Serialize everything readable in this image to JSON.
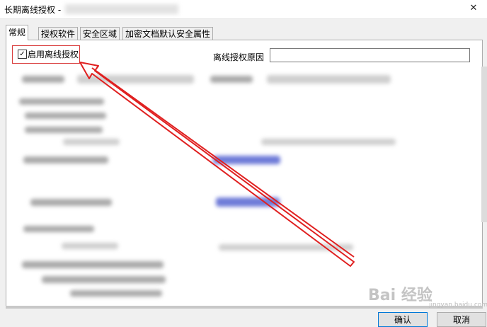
{
  "window": {
    "title": "长期离线授权 -",
    "close_glyph": "✕"
  },
  "tabs": [
    {
      "label": "常规",
      "active": true
    },
    {
      "label": "授权软件"
    },
    {
      "label": "安全区域"
    },
    {
      "label": "加密文档默认安全属性"
    }
  ],
  "general": {
    "enable_offline_checkbox": {
      "label": "启用离线授权",
      "checked": true
    },
    "reason_label": "离线授权原因",
    "reason_value": ""
  },
  "buttons": {
    "ok": "确认",
    "cancel": "取消"
  },
  "watermark": {
    "text": "Bai 经验",
    "sub": "jingyan.baidu.com"
  },
  "colors": {
    "annotation_red": "#e02020",
    "accent_blue": "#0078d7",
    "blurred_link": "#6f7bd8"
  }
}
